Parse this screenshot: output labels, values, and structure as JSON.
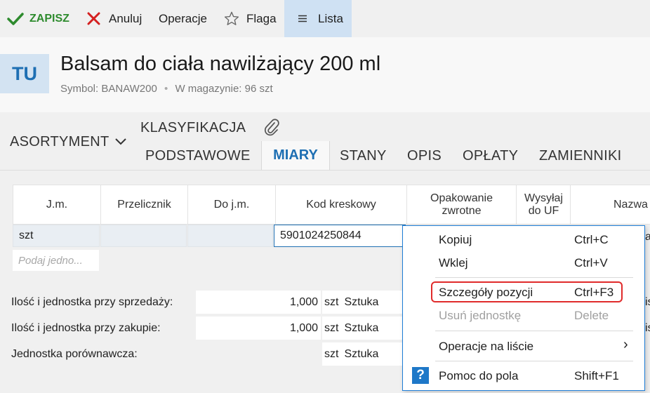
{
  "toolbar": {
    "save_label": "ZAPISZ",
    "cancel_label": "Anuluj",
    "operations_label": "Operacje",
    "flag_label": "Flaga",
    "list_label": "Lista"
  },
  "header": {
    "avatar_text": "TU",
    "title": "Balsam do ciała nawilżający 200 ml",
    "symbol_label": "Symbol: BANAW200",
    "separator": "•",
    "stock_label": "W magazynie: 96 szt"
  },
  "tabs": {
    "asortyment": "ASORTYMENT",
    "klasyfikacja": "KLASYFIKACJA",
    "items": [
      "PODSTAWOWE",
      "MIARY",
      "STANY",
      "OPIS",
      "OPŁATY",
      "ZAMIENNIKI"
    ],
    "active": "MIARY"
  },
  "grid": {
    "columns": [
      "J.m.",
      "Przelicznik",
      "Do j.m.",
      "Kod kreskowy",
      "Opakowanie zwrotne",
      "Wysyłaj do UF",
      "Nazwa"
    ],
    "row": {
      "jm": "szt",
      "przelicznik": "",
      "do_jm": "",
      "kod": "5901024250844"
    },
    "new_row_placeholder": "Podaj jedno..."
  },
  "form": {
    "sale_label": "Ilość i jednostka przy sprzedaży:",
    "sale_qty": "1,000",
    "sale_unit": "szt",
    "sale_unit_name": "Sztuka",
    "purchase_label": "Ilość i jednostka przy zakupie:",
    "purchase_qty": "1,000",
    "purchase_unit": "szt",
    "purchase_unit_name": "Sztuka",
    "compare_label": "Jednostka porównawcza:",
    "compare_unit": "szt",
    "compare_unit_name": "Sztuka",
    "right_clip_1": "a",
    "right_clip_2": "is",
    "right_clip_3": "is"
  },
  "context_menu": {
    "items": [
      {
        "label": "Kopiuj",
        "shortcut": "Ctrl+C",
        "enabled": true
      },
      {
        "label": "Wklej",
        "shortcut": "Ctrl+V",
        "enabled": true
      },
      {
        "label": "Szczegóły pozycji",
        "shortcut": "Ctrl+F3",
        "enabled": true,
        "highlighted": true
      },
      {
        "label": "Usuń jednostkę",
        "shortcut": "Delete",
        "enabled": false
      },
      {
        "label": "Operacje na liście",
        "shortcut": "›",
        "enabled": true
      },
      {
        "label": "Pomoc do pola",
        "shortcut": "Shift+F1",
        "enabled": true
      }
    ]
  },
  "colors": {
    "accent": "#1e6fb3",
    "save_green": "#2e8b2e",
    "cancel_red": "#d42020",
    "highlight_red": "#e02b2b",
    "list_active_bg": "#cfe1f3"
  }
}
